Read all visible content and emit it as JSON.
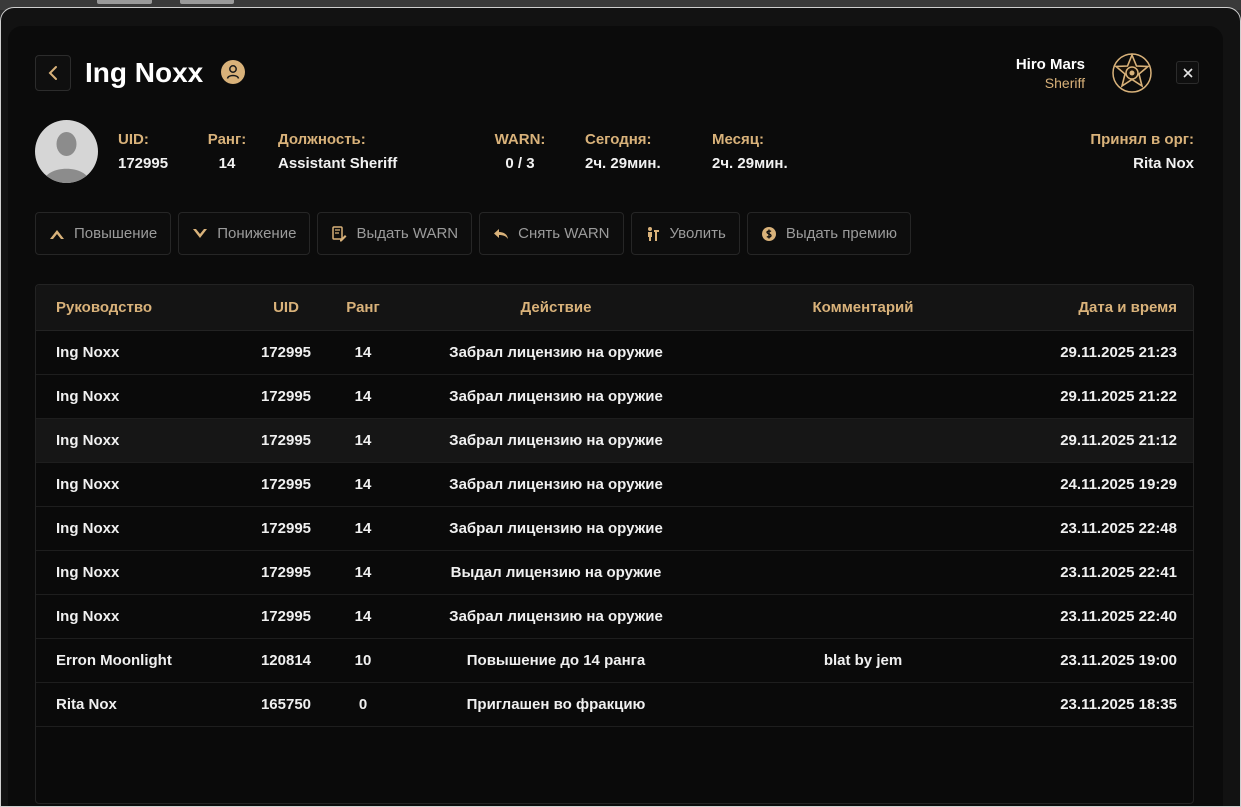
{
  "header": {
    "title": "Ing Noxx",
    "viewer_name": "Hiro Mars",
    "viewer_role": "Sheriff"
  },
  "profile": {
    "stats": [
      {
        "label": "UID:",
        "value": "172995"
      },
      {
        "label": "Ранг:",
        "value": "14"
      },
      {
        "label": "Должность:",
        "value": "Assistant Sheriff"
      },
      {
        "label": "WARN:",
        "value": "0 / 3"
      },
      {
        "label": "Сегодня:",
        "value": "2ч. 29мин."
      },
      {
        "label": "Месяц:",
        "value": "2ч. 29мин."
      },
      {
        "label": "Принял в орг:",
        "value": "Rita Nox"
      }
    ]
  },
  "actions": [
    {
      "label": "Повышение",
      "icon": "chevron-up-icon"
    },
    {
      "label": "Понижение",
      "icon": "chevron-down-icon"
    },
    {
      "label": "Выдать WARN",
      "icon": "document-pen-icon"
    },
    {
      "label": "Снять WARN",
      "icon": "undo-icon"
    },
    {
      "label": "Уволить",
      "icon": "fire-person-icon"
    },
    {
      "label": "Выдать премию",
      "icon": "coin-icon"
    }
  ],
  "table": {
    "columns": [
      "Руководство",
      "UID",
      "Ранг",
      "Действие",
      "Комментарий",
      "Дата и время"
    ],
    "rows": [
      [
        "Ing Noxx",
        "172995",
        "14",
        "Забрал лицензию на оружие",
        "",
        "29.11.2025 21:23"
      ],
      [
        "Ing Noxx",
        "172995",
        "14",
        "Забрал лицензию на оружие",
        "",
        "29.11.2025 21:22"
      ],
      [
        "Ing Noxx",
        "172995",
        "14",
        "Забрал лицензию на оружие",
        "",
        "29.11.2025 21:12"
      ],
      [
        "Ing Noxx",
        "172995",
        "14",
        "Забрал лицензию на оружие",
        "",
        "24.11.2025 19:29"
      ],
      [
        "Ing Noxx",
        "172995",
        "14",
        "Забрал лицензию на оружие",
        "",
        "23.11.2025 22:48"
      ],
      [
        "Ing Noxx",
        "172995",
        "14",
        "Выдал лицензию на оружие",
        "",
        "23.11.2025 22:41"
      ],
      [
        "Ing Noxx",
        "172995",
        "14",
        "Забрал лицензию на оружие",
        "",
        "23.11.2025 22:40"
      ],
      [
        "Erron Moonlight",
        "120814",
        "10",
        "Повышение до 14 ранга",
        "blat by jem",
        "23.11.2025 19:00"
      ],
      [
        "Rita Nox",
        "165750",
        "0",
        "Приглашен во фракцию",
        "",
        "23.11.2025 18:35"
      ]
    ]
  },
  "colors": {
    "accent": "#d9b27a",
    "background": "#0b0b0b",
    "text": "#f0f0f0",
    "muted": "#9b9b9b"
  }
}
